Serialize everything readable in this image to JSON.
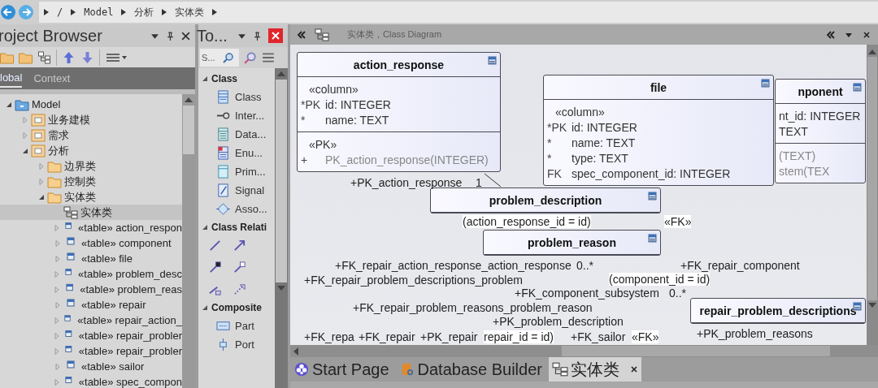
{
  "breadcrumb": [
    "/",
    "Model",
    "分析",
    "实体类"
  ],
  "project_browser": {
    "title": "roject Browser",
    "tabs": [
      {
        "label": "lobal",
        "selected": true
      },
      {
        "label": "Context",
        "selected": false
      }
    ],
    "tree": [
      {
        "label": "Model",
        "kind": "model",
        "expanded": true,
        "children": [
          {
            "label": "业务建模",
            "kind": "package",
            "expanded": false
          },
          {
            "label": "需求",
            "kind": "package",
            "expanded": false
          },
          {
            "label": "分析",
            "kind": "package",
            "expanded": true,
            "children": [
              {
                "label": "边界类",
                "kind": "folder",
                "expanded": false
              },
              {
                "label": "控制类",
                "kind": "folder",
                "expanded": false
              },
              {
                "label": "实体类",
                "kind": "folder",
                "expanded": true,
                "children": [
                  {
                    "label": "实体类",
                    "kind": "diagram",
                    "selected": true
                  },
                  {
                    "label": "«table» action_respon",
                    "kind": "table",
                    "expanded": false,
                    "selected": false
                  },
                  {
                    "label": "«table» component",
                    "kind": "table",
                    "expanded": false,
                    "selected": false
                  },
                  {
                    "label": "«table» file",
                    "kind": "table",
                    "expanded": false,
                    "selected": false
                  },
                  {
                    "label": "«table» problem_desc",
                    "kind": "table",
                    "expanded": false,
                    "selected": false
                  },
                  {
                    "label": "«table» problem_reas",
                    "kind": "table",
                    "expanded": false,
                    "selected": false
                  },
                  {
                    "label": "«table» repair",
                    "kind": "table",
                    "expanded": false,
                    "selected": false
                  },
                  {
                    "label": "«table» repair_action_",
                    "kind": "table",
                    "expanded": false,
                    "selected": false
                  },
                  {
                    "label": "«table» repair_probler",
                    "kind": "table",
                    "expanded": false,
                    "selected": false
                  },
                  {
                    "label": "«table» repair_probler",
                    "kind": "table",
                    "expanded": false,
                    "selected": false
                  },
                  {
                    "label": "«table» sailor",
                    "kind": "table",
                    "expanded": false,
                    "selected": false
                  },
                  {
                    "label": "«table» spec_compon",
                    "kind": "table",
                    "expanded": false,
                    "selected": false
                  }
                ]
              }
            ]
          }
        ]
      }
    ]
  },
  "toolbox": {
    "title": "To...",
    "search": {
      "placeholder": "S..."
    },
    "sections": [
      {
        "title": "Class",
        "expanded": true,
        "items": [
          {
            "label": "Class",
            "kind": "class"
          },
          {
            "label": "Inter...",
            "kind": "interface"
          },
          {
            "label": "Data...",
            "kind": "datatype"
          },
          {
            "label": "Enu...",
            "kind": "enumeration"
          },
          {
            "label": "Prim...",
            "kind": "primitive"
          },
          {
            "label": "Signal",
            "kind": "signal"
          },
          {
            "label": "Asso...",
            "kind": "association"
          }
        ]
      },
      {
        "title": "Class Relati",
        "expanded": true,
        "items": [
          {
            "kind": "line"
          },
          {
            "kind": "arrow"
          },
          {
            "kind": "aggregation"
          },
          {
            "kind": "composition"
          },
          {
            "kind": "nesting"
          },
          {
            "kind": "dependency"
          }
        ]
      },
      {
        "title": "Composite",
        "expanded": true,
        "items": [
          {
            "label": "Part",
            "kind": "part"
          },
          {
            "label": "Port",
            "kind": "port"
          }
        ]
      }
    ]
  },
  "diagram": {
    "title": "实体类，Class Diagram",
    "tables": [
      {
        "name": "action_response",
        "sections": [
          {
            "kind": "columns",
            "stereotype": "«column»",
            "rows": [
              {
                "flag": "*PK",
                "text": "id: INTEGER"
              },
              {
                "flag": "*",
                "text": "name: TEXT"
              }
            ]
          },
          {
            "kind": "operations",
            "stereotype": "«PK»",
            "rows": [
              {
                "flag": "+",
                "text": "PK_action_response(INTEGER)"
              }
            ]
          }
        ]
      },
      {
        "name": "file",
        "sections": [
          {
            "kind": "columns",
            "stereotype": "«column»",
            "rows": [
              {
                "flag": "*PK",
                "text": "id: INTEGER"
              },
              {
                "flag": "*",
                "text": "name: TEXT"
              },
              {
                "flag": "*",
                "text": "type: TEXT"
              },
              {
                "flag": "FK",
                "text": "spec_component_id: INTEGER"
              }
            ]
          }
        ]
      },
      {
        "name": "nponent",
        "sections": [
          {
            "kind": "columns",
            "rows": [
              {
                "text": "nt_id: INTEGER"
              },
              {
                "text": "TEXT"
              }
            ]
          },
          {
            "kind": "operations",
            "rows": [
              {
                "text": "(TEXT)"
              },
              {
                "text": "stem(TEX"
              }
            ]
          }
        ]
      },
      {
        "name": "problem_description"
      },
      {
        "name": "problem_reason"
      },
      {
        "name": "repair_problem_descriptions"
      }
    ],
    "labels": [
      {
        "text": "+PK_action_response",
        "kind": "role"
      },
      {
        "text": "1",
        "kind": "multiplicity"
      },
      {
        "text": "(action_response_id = id)",
        "kind": "constraint"
      },
      {
        "text": "«FK»",
        "kind": "stereotype"
      },
      {
        "text": "+FK_repair_action_response_action_response",
        "kind": "role"
      },
      {
        "text": "0..*",
        "kind": "multiplicity"
      },
      {
        "text": "+FK_repair_component",
        "kind": "role"
      },
      {
        "text": "+FK_repair_problem_descriptions_problem",
        "kind": "role"
      },
      {
        "text": "(component_id = id)",
        "kind": "constraint"
      },
      {
        "text": "+FK_component_subsystem",
        "kind": "role"
      },
      {
        "text": "0..*",
        "kind": "multiplicity"
      },
      {
        "text": "+FK_repair_problem_reasons_problem_reason",
        "kind": "role"
      },
      {
        "text": "+PK_problem_description",
        "kind": "role"
      },
      {
        "text": "+FK_repa",
        "kind": "role"
      },
      {
        "text": "+FK_repair",
        "kind": "role"
      },
      {
        "text": "+PK_repair",
        "kind": "role"
      },
      {
        "text": "repair_id = id)",
        "kind": "constraint"
      },
      {
        "text": "+FK_sailor",
        "kind": "role"
      },
      {
        "text": "«FK»",
        "kind": "stereotype"
      },
      {
        "text": "+PK_problem_reasons",
        "kind": "role"
      }
    ]
  },
  "document_tabs": [
    {
      "label": "Start Page",
      "kind": "start",
      "selected": false
    },
    {
      "label": "Database Builder",
      "kind": "database",
      "selected": false
    },
    {
      "label": "实体类",
      "kind": "diagram",
      "selected": true
    }
  ]
}
